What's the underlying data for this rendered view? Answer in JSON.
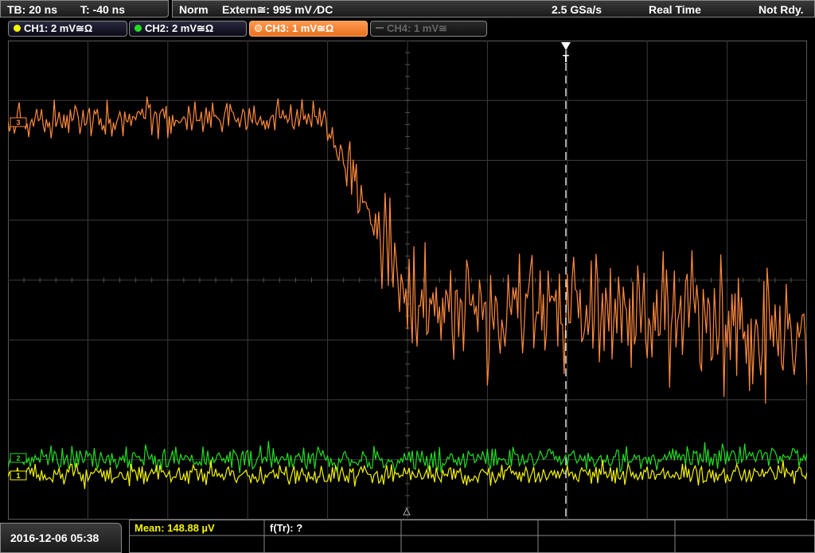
{
  "header": {
    "timebase": "TB: 20 ns",
    "trigger_time": "T: -40 ns",
    "trigger_mode": "Norm",
    "trigger_source": "Extern≅: 995 mV ∕DC",
    "sample_rate": "2.5 GSa/s",
    "acq_mode": "Real Time",
    "status": "Not Rdy."
  },
  "channels": [
    {
      "label": "CH1: 2 mV≅Ω",
      "color": "#f5f500",
      "active": true
    },
    {
      "label": "CH2: 2 mV≅Ω",
      "color": "#22dd22",
      "active": true
    },
    {
      "label": "CH3: 1 mV≅Ω",
      "color": "#ff8a3c",
      "active": true
    },
    {
      "label": "CH4: 1 mV≅",
      "color": "#777777",
      "active": false
    }
  ],
  "markers": {
    "ch3": "3",
    "ch2": "2",
    "ch1": "1",
    "trigger": "T"
  },
  "footer": {
    "datetime": "2016-12-06 05:38",
    "measurement_1": "Mean: 148.88 µV",
    "measurement_2": "f(Tr): ?"
  },
  "colors": {
    "grid": "#555555",
    "ch1": "#f5f500",
    "ch2": "#22dd22",
    "ch3": "#ff8a3c",
    "panel_border": "#888888"
  }
}
